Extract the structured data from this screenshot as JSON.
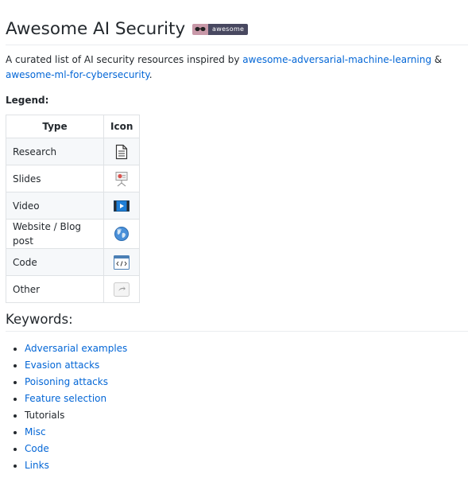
{
  "header": {
    "title": "Awesome AI Security",
    "badge_label": "awesome"
  },
  "intro": {
    "text_before": "A curated list of AI security resources inspired by ",
    "link1": "awesome-adversarial-machine-learning",
    "text_between": " & ",
    "link2": "awesome-ml-for-cybersecurity",
    "text_after": "."
  },
  "legend": {
    "label": "Legend:",
    "headers": [
      "Type",
      "Icon"
    ],
    "rows": [
      {
        "type": "Research",
        "icon": "document-icon"
      },
      {
        "type": "Slides",
        "icon": "presentation-icon"
      },
      {
        "type": "Video",
        "icon": "video-icon"
      },
      {
        "type": "Website / Blog post",
        "icon": "globe-icon"
      },
      {
        "type": "Code",
        "icon": "code-icon"
      },
      {
        "type": "Other",
        "icon": "other-icon"
      }
    ]
  },
  "keywords": {
    "heading": "Keywords:",
    "items": [
      {
        "label": "Adversarial examples",
        "link": true
      },
      {
        "label": "Evasion attacks",
        "link": true
      },
      {
        "label": "Poisoning attacks",
        "link": true
      },
      {
        "label": "Feature selection",
        "link": true
      },
      {
        "label": "Tutorials",
        "link": false
      },
      {
        "label": "Misc",
        "link": true
      },
      {
        "label": "Code",
        "link": true
      },
      {
        "label": "Links",
        "link": true
      }
    ]
  },
  "colors": {
    "link": "#0366d6",
    "text": "#24292e",
    "border": "#dfe2e5"
  }
}
